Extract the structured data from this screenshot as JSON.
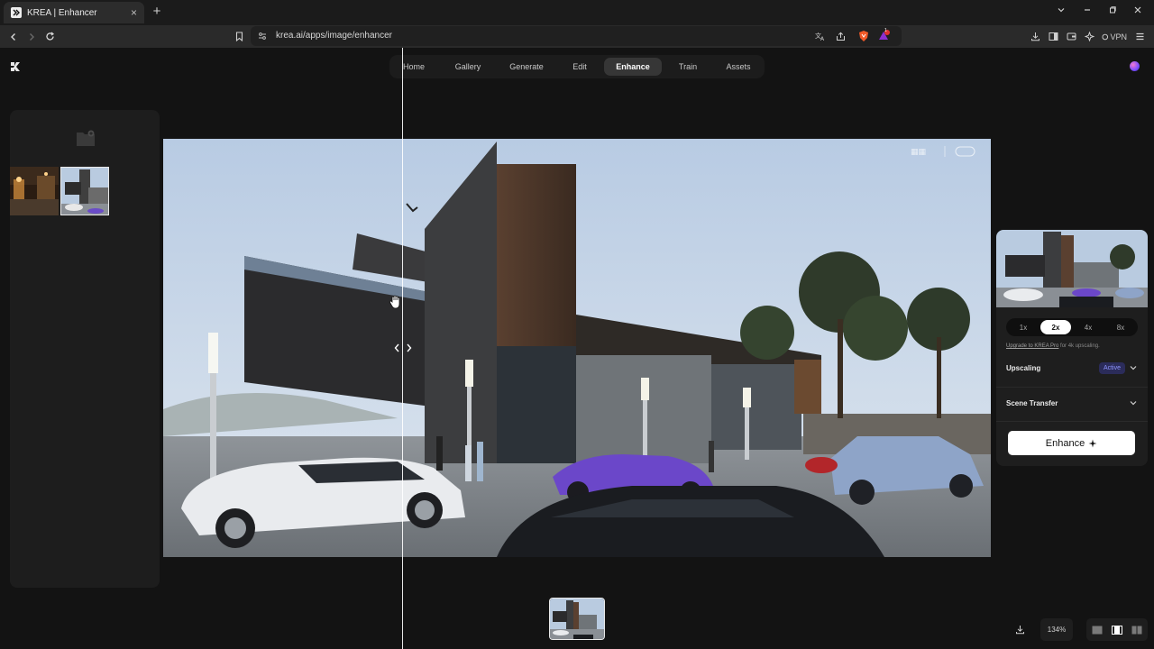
{
  "browser": {
    "tab_title": "KREA | Enhancer",
    "tab_close": "×",
    "new_tab": "+",
    "url": "krea.ai/apps/image/enhancer",
    "vpn_label": "VPN",
    "ext_badge": "1"
  },
  "nav": {
    "items": [
      {
        "label": "Home"
      },
      {
        "label": "Gallery"
      },
      {
        "label": "Generate"
      },
      {
        "label": "Edit"
      },
      {
        "label": "Enhance"
      },
      {
        "label": "Train"
      },
      {
        "label": "Assets"
      }
    ],
    "active": "Enhance"
  },
  "enhancer": {
    "scale_options": [
      "1x",
      "2x",
      "4x",
      "8x"
    ],
    "selected_scale": "2x",
    "upgrade_link": "Upgrade to KREA Pro",
    "upgrade_suffix": " for 4k upscaling.",
    "upscaling_label": "Upscaling",
    "upscaling_badge": "Active",
    "scene_transfer_label": "Scene Transfer",
    "enhance_button": "Enhance"
  },
  "footer": {
    "zoom": "134%"
  },
  "colors": {
    "accent_badge_bg": "#2b2c5a",
    "accent_badge_text": "#8f95ff",
    "active_nav_bg": "#363636",
    "button_bg": "#ffffff"
  },
  "icons": {
    "logo": "krea-logo-icon",
    "download": "download-icon",
    "folder": "folder-icon",
    "view_modes": [
      "single-view-icon",
      "split-view-icon",
      "side-by-side-icon"
    ]
  }
}
